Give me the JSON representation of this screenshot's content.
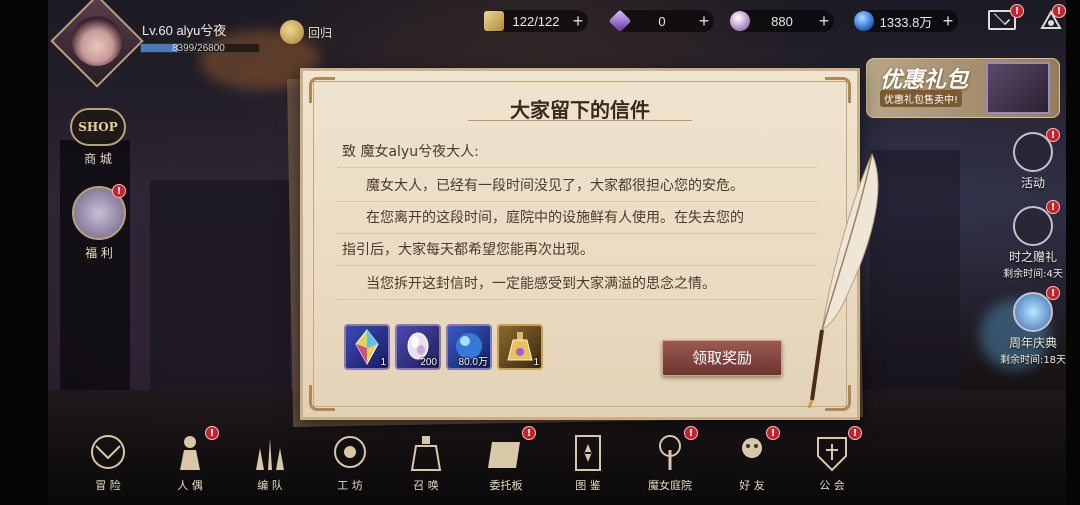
{
  "player": {
    "level_label": "Lv.60  alyu兮夜",
    "exp_text": "8399/26800",
    "exp_fraction": 0.313
  },
  "return_label": "回归",
  "resources": [
    {
      "name": "stamina",
      "value": "122/122",
      "plus": "+",
      "icon": "scroll-icon",
      "color": "#d8b860"
    },
    {
      "name": "crystal",
      "value": "0",
      "plus": "+",
      "icon": "purple-crystal-icon",
      "color": "#a070d0"
    },
    {
      "name": "gem",
      "value": "880",
      "plus": "+",
      "icon": "rainbow-gem-icon",
      "color": "#c0a0d0"
    },
    {
      "name": "gold",
      "value": "1333.8万",
      "plus": "+",
      "icon": "blue-orb-icon",
      "color": "#3a78d8"
    }
  ],
  "left_menu": {
    "shop_badge": "SHOP",
    "shop_label": "商 城",
    "welfare_label": "福 利"
  },
  "right_menu": {
    "gift_title": "优惠礼包",
    "gift_sub": "优惠礼包售卖中!",
    "activity_label": "活动",
    "time_gift_label": "时之赠礼",
    "time_gift_sub": "剩余时间:4天",
    "anniversary_label": "周年庆典",
    "anniversary_sub": "剩余时间:18天"
  },
  "dialog": {
    "title": "大家留下的信件",
    "greeting": "致 魔女alyu兮夜大人:",
    "paragraph1": "魔女大人，已经有一段时间没见了，大家都很担心您的安危。",
    "paragraph2a": "在您离开的这段时间，庭院中的设施鲜有人使用。在失去您的",
    "paragraph2b": "指引后，大家每天都希望您能再次出现。",
    "paragraph3": "当您拆开这封信时，一定能感受到大家满溢的思念之情。",
    "claim_button": "领取奖励",
    "rewards": [
      {
        "icon": "rainbow-crystal-icon",
        "count": "1"
      },
      {
        "icon": "gem-icon",
        "count": "200"
      },
      {
        "icon": "blue-orb-icon",
        "count": "80.0万"
      },
      {
        "icon": "potion-icon",
        "count": "1"
      }
    ]
  },
  "bottom_nav": [
    {
      "label": "冒 险",
      "icon": "adventure-icon"
    },
    {
      "label": "人 偶",
      "icon": "doll-icon"
    },
    {
      "label": "编 队",
      "icon": "formation-icon"
    },
    {
      "label": "工 坊",
      "icon": "workshop-icon"
    },
    {
      "label": "召 唤",
      "icon": "summon-icon"
    },
    {
      "label": "委托板",
      "icon": "commission-icon"
    },
    {
      "label": "图 鉴",
      "icon": "codex-icon"
    },
    {
      "label": "魔女庭院",
      "icon": "courtyard-icon"
    },
    {
      "label": "好 友",
      "icon": "friends-icon"
    },
    {
      "label": "公 会",
      "icon": "guild-icon"
    }
  ],
  "badge_mark": "!"
}
